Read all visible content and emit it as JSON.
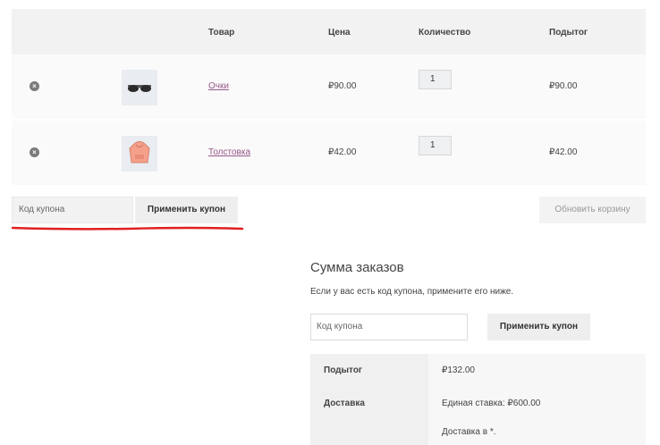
{
  "cart": {
    "headers": {
      "product": "Товар",
      "price": "Цена",
      "quantity": "Количество",
      "subtotal": "Подытог"
    },
    "items": [
      {
        "name": "Очки",
        "price": "₽90.00",
        "quantity": "1",
        "subtotal": "₽90.00",
        "icon": "sunglasses-thumbnail"
      },
      {
        "name": "Толстовка",
        "price": "₽42.00",
        "quantity": "1",
        "subtotal": "₽42.00",
        "icon": "hoodie-thumbnail"
      }
    ],
    "remove_icon": "×"
  },
  "coupon_bar": {
    "placeholder": "Код купона",
    "apply_label": "Применить купон",
    "update_label": "Обновить корзину",
    "highlight_color": "#e02020"
  },
  "totals": {
    "title": "Сумма заказов",
    "hint": "Если у вас есть код купона, примените его ниже.",
    "coupon_placeholder": "Код купона",
    "apply_label": "Применить купон",
    "subtotal_label": "Подытог",
    "subtotal_value": "₽132.00",
    "shipping_label": "Доставка",
    "shipping_value": "Единая ставка: ₽600.00",
    "shipping_to": "Доставка в *."
  },
  "colors": {
    "link": "#96588a",
    "header_bg": "#f2f2f2",
    "row_bg": "#fafafa"
  }
}
